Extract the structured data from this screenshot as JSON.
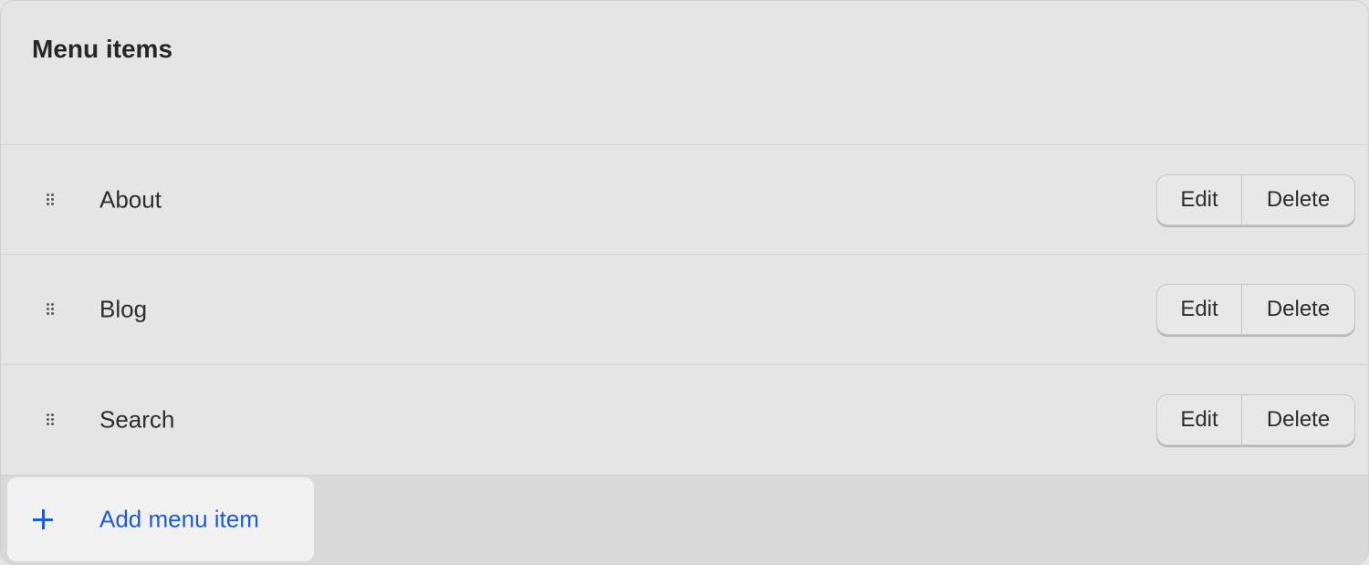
{
  "card": {
    "title": "Menu items"
  },
  "menu_items": [
    {
      "label": "About",
      "edit_label": "Edit",
      "delete_label": "Delete"
    },
    {
      "label": "Blog",
      "edit_label": "Edit",
      "delete_label": "Delete"
    },
    {
      "label": "Search",
      "edit_label": "Edit",
      "delete_label": "Delete"
    }
  ],
  "footer": {
    "add_label": "Add menu item",
    "add_icon": "plus-icon"
  },
  "colors": {
    "accent": "#1f5bd1",
    "background": "#e5e5e5"
  }
}
